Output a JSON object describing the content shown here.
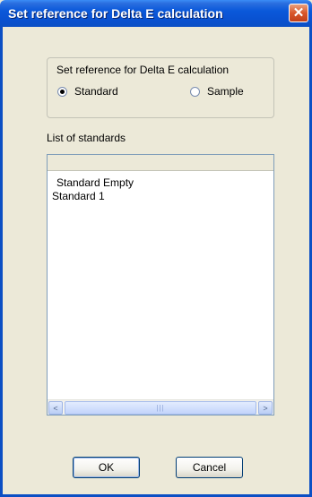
{
  "window": {
    "title": "Set reference for Delta E calculation",
    "close_glyph": "✕"
  },
  "group": {
    "title": "Set reference for Delta E calculation",
    "options": [
      {
        "label": "Standard",
        "checked": true
      },
      {
        "label": "Sample",
        "checked": false
      }
    ]
  },
  "list": {
    "label": "List of standards",
    "items": [
      "Standard Empty",
      "Standard 1"
    ],
    "scroll_left_glyph": "<",
    "scroll_right_glyph": ">",
    "thumb_grip": "|||"
  },
  "buttons": {
    "ok": "OK",
    "cancel": "Cancel"
  },
  "colors": {
    "titlebar": "#0a58da",
    "dialog_bg": "#ece9d8",
    "close": "#d9572b"
  }
}
